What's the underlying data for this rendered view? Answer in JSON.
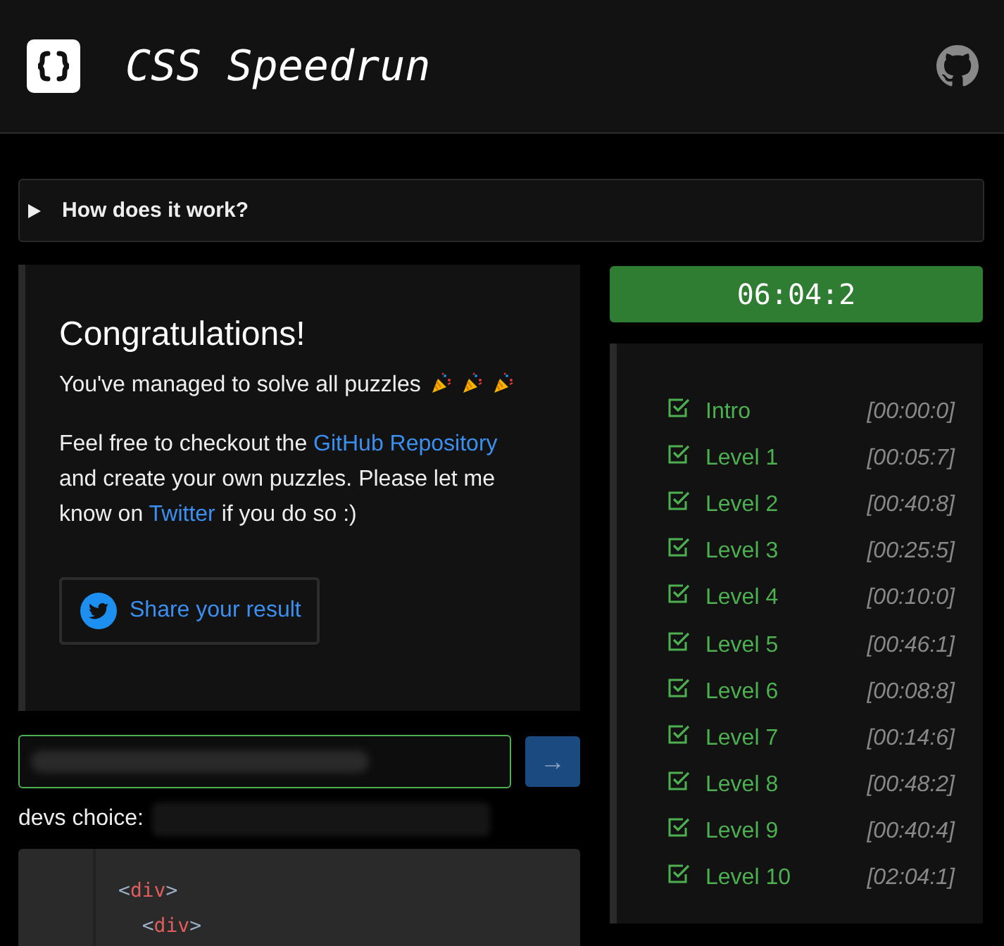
{
  "header": {
    "title": "CSS Speedrun"
  },
  "details": {
    "summary": "How does it work?",
    "expanded": false
  },
  "congrats": {
    "heading": "Congratulations!",
    "message": "You've managed to solve all puzzles",
    "decorations": [
      {
        "kind": "party"
      },
      {
        "kind": "party"
      },
      {
        "kind": "party"
      }
    ],
    "paragraph": [
      {
        "kind": "text",
        "text": "Feel free to checkout the "
      },
      {
        "kind": "link",
        "text": "GitHub Repository"
      },
      {
        "kind": "text",
        "text": " and create your own puzzles. Please let me know on "
      },
      {
        "kind": "link",
        "text": "Twitter"
      },
      {
        "kind": "text",
        "text": " if you do so :)"
      }
    ],
    "share_button": "Share your result"
  },
  "answer": {
    "submit": "→",
    "devs_choice_label": "devs choice:"
  },
  "code_lines": [
    [
      {
        "kind": "punct",
        "text": "<"
      },
      {
        "kind": "tag",
        "text": "div"
      },
      {
        "kind": "punct",
        "text": ">"
      }
    ],
    [
      {
        "kind": "punct",
        "text": "  <"
      },
      {
        "kind": "tag",
        "text": "div"
      },
      {
        "kind": "punct",
        "text": ">"
      }
    ]
  ],
  "timer": "06:04:2",
  "levels": [
    {
      "name": "Intro",
      "time": "[00:00:0]",
      "checked": true
    },
    {
      "name": "Level 1",
      "time": "[00:05:7]",
      "checked": true
    },
    {
      "name": "Level 2",
      "time": "[00:40:8]",
      "checked": true
    },
    {
      "name": "Level 3",
      "time": "[00:25:5]",
      "checked": true
    },
    {
      "name": "Level 4",
      "time": "[00:10:0]",
      "checked": true
    },
    {
      "name": "Level 5",
      "time": "[00:46:1]",
      "checked": true
    },
    {
      "name": "Level 6",
      "time": "[00:08:8]",
      "checked": true
    },
    {
      "name": "Level 7",
      "time": "[00:14:6]",
      "checked": true
    },
    {
      "name": "Level 8",
      "time": "[00:48:2]",
      "checked": true
    },
    {
      "name": "Level 9",
      "time": "[00:40:4]",
      "checked": true
    },
    {
      "name": "Level 10",
      "time": "[02:04:1]",
      "checked": true
    }
  ]
}
